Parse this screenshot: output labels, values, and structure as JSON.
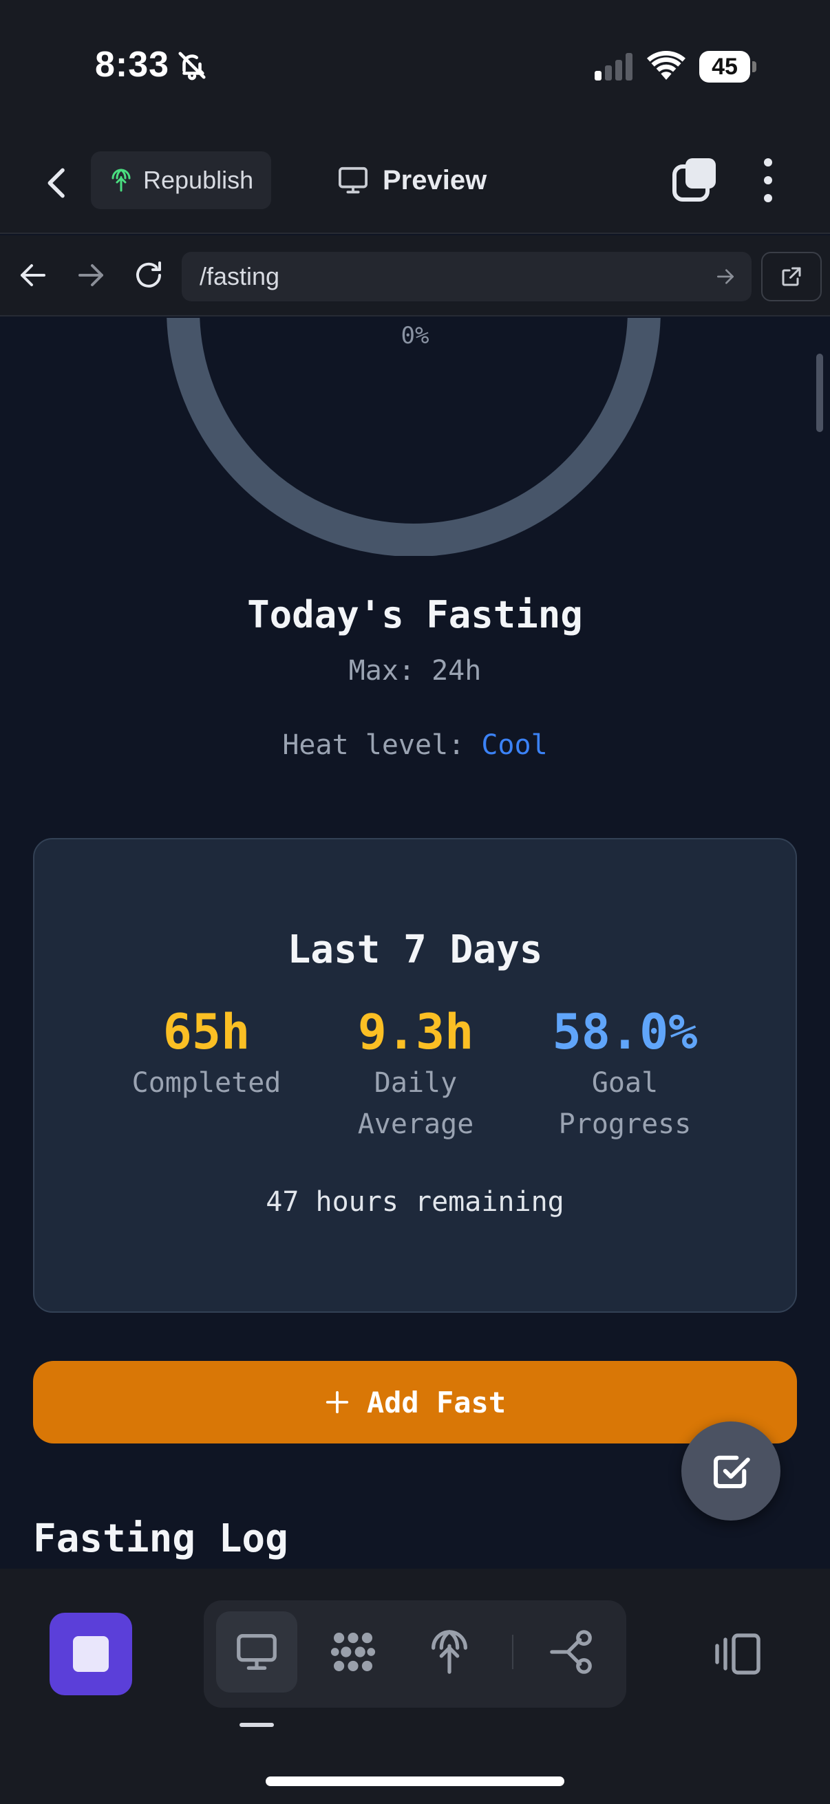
{
  "status_bar": {
    "time": "8:33",
    "battery": "45",
    "icons": [
      "bell-slash-icon",
      "signal-icon",
      "wifi-icon",
      "battery-icon"
    ]
  },
  "app_header": {
    "republish_label": "Republish",
    "preview_label": "Preview",
    "icons": [
      "chevron-left-icon",
      "antenna-icon",
      "monitor-icon",
      "tabs-icon",
      "more-vertical-icon"
    ]
  },
  "browser": {
    "url": "/fasting",
    "icons": [
      "arrow-left-icon",
      "arrow-right-icon",
      "reload-icon",
      "url-go-icon",
      "external-link-icon"
    ]
  },
  "fasting": {
    "progress_label": "0%",
    "progress": 0,
    "title": "Today's Fasting",
    "max_label": "Max: 24h",
    "heat_prefix": "Heat level:",
    "heat_value": "Cool",
    "heat_color": "#3b82f6",
    "ring_color": "#475569"
  },
  "summary": {
    "title": "Last 7 Days",
    "stats": [
      {
        "value": "65h",
        "label": "Completed",
        "color": "#fbbf24"
      },
      {
        "value": "9.3h",
        "label": "Daily Average",
        "color": "#fbbf24"
      },
      {
        "value": "58.0%",
        "label": "Goal Progress",
        "color": "#60a5fa"
      }
    ],
    "remaining": "47 hours remaining"
  },
  "add_button": {
    "label": "Add Fast",
    "color": "#d97706",
    "icon": "plus-icon"
  },
  "fab": {
    "icon": "checkbox-edit-icon"
  },
  "log": {
    "title": "Fasting Log"
  },
  "toolbar": {
    "accent": "#5b3fd9",
    "icons": [
      "stop-icon",
      "monitor-icon",
      "dots-cluster-icon",
      "antenna-icon",
      "share-nodes-icon",
      "split-panel-icon"
    ]
  }
}
